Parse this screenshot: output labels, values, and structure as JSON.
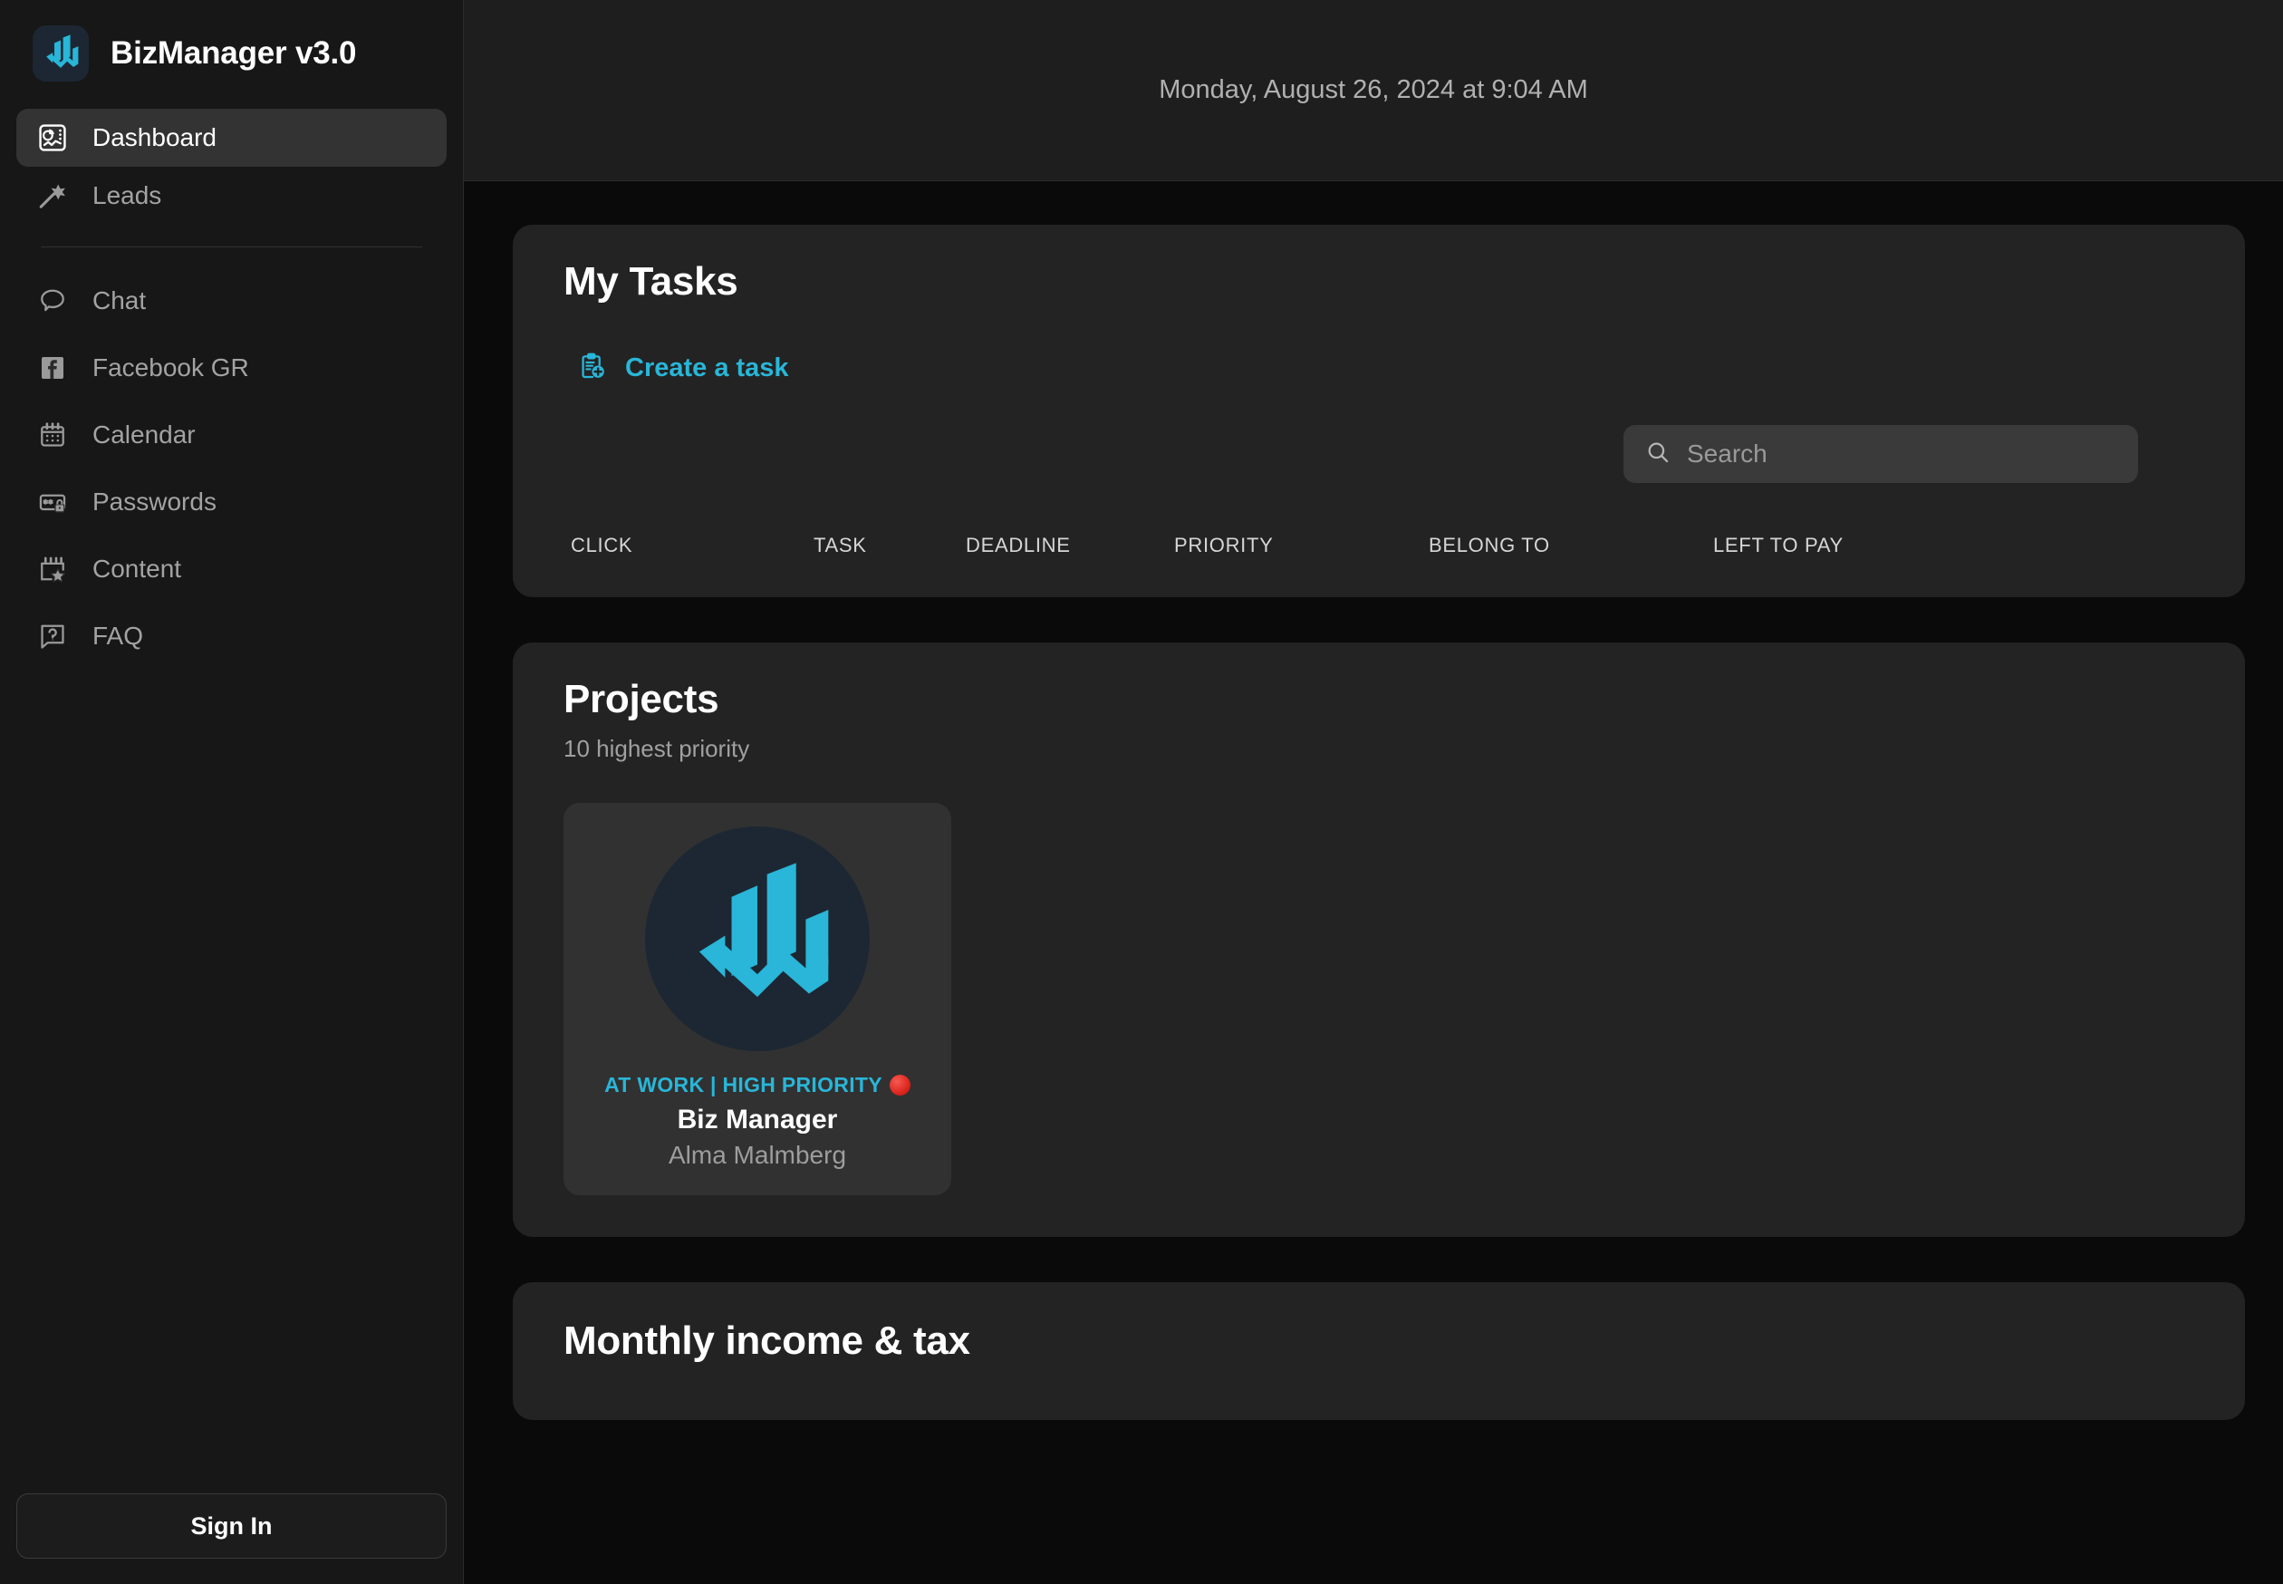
{
  "app": {
    "brand_title": "BizManager v3.0",
    "brand_logo_icon": "bizmanager-logo-icon"
  },
  "sidebar": {
    "primary_items": [
      {
        "label": "Dashboard",
        "icon": "dashboard-icon",
        "active": true
      },
      {
        "label": "Leads",
        "icon": "magic-wand-icon",
        "active": false
      }
    ],
    "secondary_items": [
      {
        "label": "Chat",
        "icon": "chat-bubble-icon"
      },
      {
        "label": "Facebook GR",
        "icon": "facebook-icon"
      },
      {
        "label": "Calendar",
        "icon": "calendar-icon"
      },
      {
        "label": "Passwords",
        "icon": "password-lock-icon"
      },
      {
        "label": "Content",
        "icon": "content-star-icon"
      },
      {
        "label": "FAQ",
        "icon": "faq-question-icon"
      }
    ],
    "signin_label": "Sign In"
  },
  "topbar": {
    "datetime": "Monday, August 26, 2024 at 9:04 AM"
  },
  "tasks_panel": {
    "title": "My Tasks",
    "create_task_label": "Create a task",
    "create_task_icon": "clipboard-plus-icon",
    "search": {
      "placeholder": "Search",
      "value": "",
      "icon": "search-icon"
    },
    "columns": [
      "CLICK",
      "TASK",
      "DEADLINE",
      "PRIORITY",
      "BELONG TO",
      "LEFT TO PAY"
    ],
    "rows": []
  },
  "projects_panel": {
    "title": "Projects",
    "subtitle": "10 highest priority",
    "cards": [
      {
        "status": "AT WORK | HIGH PRIORITY",
        "priority_dot": "red-priority-dot",
        "name": "Biz Manager",
        "owner": "Alma Malmberg",
        "avatar_icon": "bizmanager-logo-icon"
      }
    ]
  },
  "monthly_panel": {
    "title": "Monthly income & tax"
  },
  "colors": {
    "accent": "#29b6d8",
    "panel_bg": "#232323",
    "sidebar_bg": "#171717",
    "content_bg": "#0a0a0a",
    "topbar_bg": "#1e1e1e",
    "priority_red": "#e02a23"
  }
}
